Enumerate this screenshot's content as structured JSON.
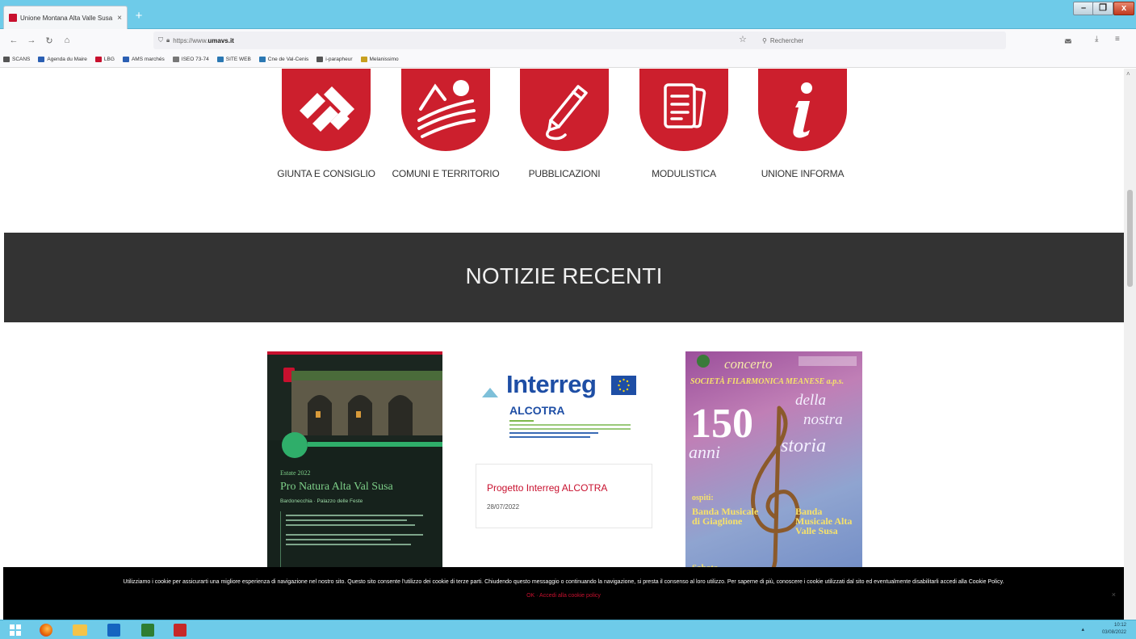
{
  "browser": {
    "tab_title": "Unione Montana Alta Valle Susa",
    "tab_close": "×",
    "new_tab": "+",
    "url_prefix": "https://www.",
    "url_domain": "umavs.it",
    "search_placeholder": "Rechercher",
    "window_controls": {
      "minimize": "–",
      "maximize": "❐",
      "close": "x"
    }
  },
  "bookmarks": [
    {
      "label": "SCANS",
      "color": "#555555"
    },
    {
      "label": "Agenda du Maire",
      "color": "#2b5fb3"
    },
    {
      "label": "LBG",
      "color": "#c8102e"
    },
    {
      "label": "AMS marchés",
      "color": "#2b5fb3"
    },
    {
      "label": "ISEO 73-74",
      "color": "#777777"
    },
    {
      "label": "SITE WEB",
      "color": "#2b78b3"
    },
    {
      "label": "Cne de Val-Cenis",
      "color": "#2b78b3"
    },
    {
      "label": "i-parapheur",
      "color": "#555555"
    },
    {
      "label": "Melanissimo",
      "color": "#c8a020"
    }
  ],
  "quicklinks": [
    {
      "label": "GIUNTA E CONSIGLIO",
      "icon": "giunta-logo-icon"
    },
    {
      "label": "COMUNI E TERRITORIO",
      "icon": "mountain-landscape-icon"
    },
    {
      "label": "PUBBLICAZIONI",
      "icon": "pencil-icon"
    },
    {
      "label": "MODULISTICA",
      "icon": "documents-icon"
    },
    {
      "label": "UNIONE INFORMA",
      "icon": "info-icon"
    }
  ],
  "news": {
    "section_title": "NOTIZIE RECENTI",
    "card1": {
      "season": "Estate 2022",
      "title": "Pro Natura Alta Val Susa",
      "subtitle": "Bardonecchia · Palazzo delle Feste"
    },
    "card2": {
      "brand": "Interreg",
      "program": "ALCOTRA",
      "title": "Progetto Interreg ALCOTRA",
      "date": "28/07/2022"
    },
    "card3": {
      "header": "concerto",
      "society": "SOCIETÀ FILARMONICA MEANESE a.p.s.",
      "number": "150",
      "word_anni": "anni",
      "word_della": "della",
      "word_nostra": "nostra",
      "word_storia": "storia",
      "ospiti": "ospiti:",
      "guest1": "Banda Musicale di Giaglione",
      "guest2": "Banda Musicale Alta Valle Susa",
      "sabato": "Sabato"
    }
  },
  "cookie": {
    "text": "Utilizziamo i cookie per assicurarti una migliore esperienza di navigazione nel nostro sito. Questo sito consente l'utilizzo dei cookie di terze parti. Chiudendo questo messaggio o continuando la navigazione, si presta il consenso al loro utilizzo. Per saperne di più, conoscere i cookie utilizzati dal sito ed eventualmente disabilitarli accedi alla Cookie Policy.",
    "actions": "OK · Accedi alla cookie policy",
    "close": "×"
  },
  "taskbar": {
    "time": "10:12",
    "date": "03/08/2022"
  },
  "colors": {
    "accent": "#cc1f2d",
    "band": "#333333",
    "taskbar": "#6ecbe9"
  }
}
